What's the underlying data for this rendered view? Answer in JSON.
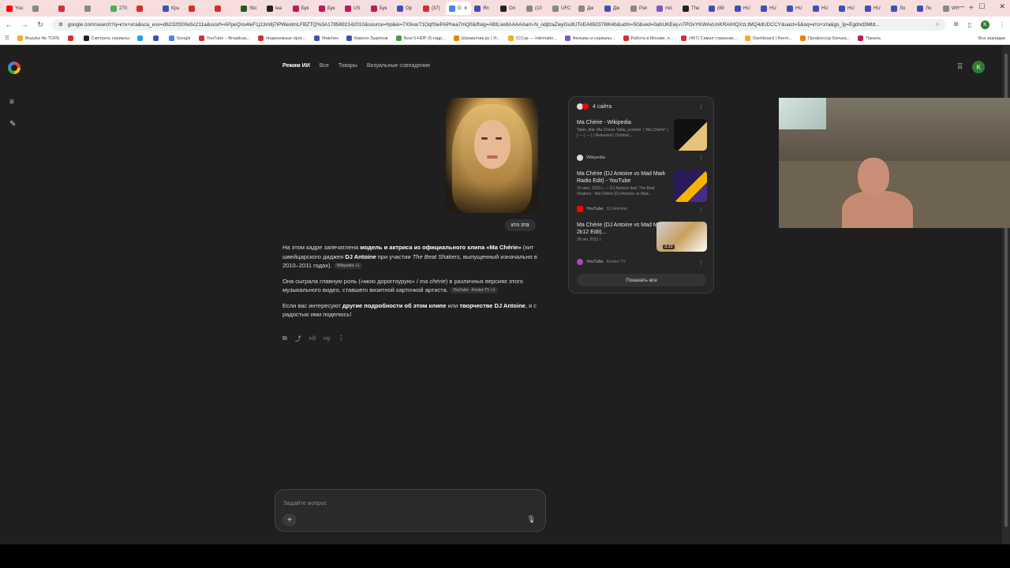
{
  "tabs": [
    {
      "label": "You",
      "color": "#ff0000"
    },
    {
      "label": "",
      "color": "#888"
    },
    {
      "label": "",
      "color": "#d32f2f"
    },
    {
      "label": "",
      "color": "#888"
    },
    {
      "label": "270",
      "color": "#4caf50"
    },
    {
      "label": "",
      "color": "#d32f2f"
    },
    {
      "label": "Крэ",
      "color": "#3f51b5"
    },
    {
      "label": "",
      "color": "#d32f2f"
    },
    {
      "label": "",
      "color": "#d32f2f"
    },
    {
      "label": "Sto",
      "color": "#1b5e20"
    },
    {
      "label": "lea",
      "color": "#222"
    },
    {
      "label": "Бук",
      "color": "#c2185b"
    },
    {
      "label": "Бук",
      "color": "#c2185b"
    },
    {
      "label": "US",
      "color": "#c2185b"
    },
    {
      "label": "Бук",
      "color": "#c2185b"
    },
    {
      "label": "Ор",
      "color": "#3f51b5"
    },
    {
      "label": "(37)",
      "color": "#d32f2f"
    },
    {
      "label": "G",
      "color": "#4285f4",
      "active": true
    },
    {
      "label": "Яп",
      "color": "#3f51b5"
    },
    {
      "label": "Оп",
      "color": "#222"
    },
    {
      "label": "(10",
      "color": "#888"
    },
    {
      "label": "UFC",
      "color": "#888"
    },
    {
      "label": "Дж",
      "color": "#888"
    },
    {
      "label": "Дж",
      "color": "#3f51b5"
    },
    {
      "label": "Рэп",
      "color": "#888"
    },
    {
      "label": "mic",
      "color": "#7e57c2"
    },
    {
      "label": "The",
      "color": "#222"
    },
    {
      "label": "(89",
      "color": "#3f51b5"
    },
    {
      "label": "HU",
      "color": "#3f51b5"
    },
    {
      "label": "HU",
      "color": "#3f51b5"
    },
    {
      "label": "HU",
      "color": "#3f51b5"
    },
    {
      "label": "HU",
      "color": "#3f51b5"
    },
    {
      "label": "HU",
      "color": "#3f51b5"
    },
    {
      "label": "HU",
      "color": "#3f51b5"
    },
    {
      "label": "Ло",
      "color": "#3f51b5"
    },
    {
      "label": "Ло",
      "color": "#3f51b5"
    },
    {
      "label": "Wh",
      "color": "#888"
    }
  ],
  "toolbar": {
    "url": "google.com/search?q=кто+эта&sca_esv=d6232f200e5c211a&sxsrf=APpeQns4leF1j13m9j7iPWestmLFBZTQ%3A1785692142010&source=hp&ei=7X9var71OqfSwPAPhea7mQ0&iflsig=ABILxe8AAAAAam-N_odjtzaZwyGu8UToEA650378lK4b&udm=50&ved=0ahUKEwj-n7POvYKWAxUnKRAIHQXzLtMQ4dUDCCY&uact=5&oq=кто+эта&gs_lp=Egdnd3Mtd..."
  },
  "bookmarks": [
    {
      "label": "Muzyka Ne TOPE",
      "color": "#f9a825"
    },
    {
      "label": "",
      "color": "#d32f2f"
    },
    {
      "label": "Смотреть сериалы",
      "color": "#222"
    },
    {
      "label": "",
      "color": "#1da1f2"
    },
    {
      "label": "",
      "color": "#3f51b5"
    },
    {
      "label": "Google",
      "color": "#4285f4"
    },
    {
      "label": "YouTube – Broadcas...",
      "color": "#d32f2f"
    },
    {
      "label": "Неденежные прос...",
      "color": "#d32f2f"
    },
    {
      "label": "Matches",
      "color": "#3f51b5"
    },
    {
      "label": "Кирилл Зырянов",
      "color": "#3f51b5"
    },
    {
      "label": "Now 5-HDP (5-гидр...",
      "color": "#43a047"
    },
    {
      "label": "Шахматчик.ру | Уг...",
      "color": "#f57c00"
    },
    {
      "label": "ICCup — Internatio...",
      "color": "#f9a825"
    },
    {
      "label": "Фильмы и сериалы...",
      "color": "#7e57c2"
    },
    {
      "label": "Работа в Москве, п...",
      "color": "#d32f2f"
    },
    {
      "label": "(467) Самая странная...",
      "color": "#d32f2f"
    },
    {
      "label": "Dashboard | therm...",
      "color": "#f9a825"
    },
    {
      "label": "Профессор Битька...",
      "color": "#f57c00"
    },
    {
      "label": "Панель",
      "color": "#c2185b"
    }
  ],
  "bookmarks_all": "Все закладки",
  "nav": {
    "tabs": [
      "Режим ИИ",
      "Все",
      "Товары",
      "Визуальные совпадения"
    ]
  },
  "user": {
    "initial": "K"
  },
  "query": {
    "text": "кто эта"
  },
  "answer": {
    "p1_a": "На этом кадре запечатлена ",
    "p1_b": "модель и актриса из официального клипа «Ma Chérie»",
    "p1_c": " (хит швейцарского диджея ",
    "p1_d": "DJ Antoine",
    "p1_e": " при участии ",
    "p1_f": "The Beat Shakers",
    "p1_g": ", выпущенный изначально в 2010–2011 годах).",
    "p1_chip": "Wikipedia +1",
    "p2_a": "Она сыграла главную роль («мою дороггоурую» / ",
    "p2_b": "ma chérie",
    "p2_c": ") в различных версиях этого музыкального видео, ставшего визитной карточкой артиста.",
    "p2_chip": "YouTube · Kontor.TV +1",
    "p3_a": "Если вас интересуют ",
    "p3_b": "другие подробности об этом клипе",
    "p3_c": " или ",
    "p3_d": "творчестве DJ Antoine",
    "p3_e": ", я с радостью ими поделюсь!"
  },
  "sources": {
    "count_label": "4 сайта",
    "items": [
      {
        "title": "Ma Chérie - Wikipedia",
        "snippet": "Table_title: Ma Chérie Table_content: | \"Ma Chérie\" | | --- | --- | | Released | October...",
        "site": "Wikipedia",
        "sub": "",
        "thumb_color": "#1a1a1a"
      },
      {
        "title": "Ma Chérie (DJ Antoine vs Mad Mark Radio Edit) - YouTube",
        "snippet": "10 июн. 2010 г. — DJ Antoine feat. The Beat Shakers - Ma Chérie (DJ Antoine vs Mad...",
        "site": "YouTube",
        "sub": "DJ Antoine",
        "thumb_color": "#3b1e6e"
      },
      {
        "title": "Ma Chérie (DJ Antoine vs Mad Mark 2k12 Edit)...",
        "snippet": "28 окт. 2011 г.",
        "site": "YouTube",
        "sub": "Kontor.TV",
        "thumb_color": "#c9b08a",
        "duration": "3:22"
      }
    ],
    "show_all": "Показать все"
  },
  "ask": {
    "placeholder": "Задайте вопрос"
  }
}
